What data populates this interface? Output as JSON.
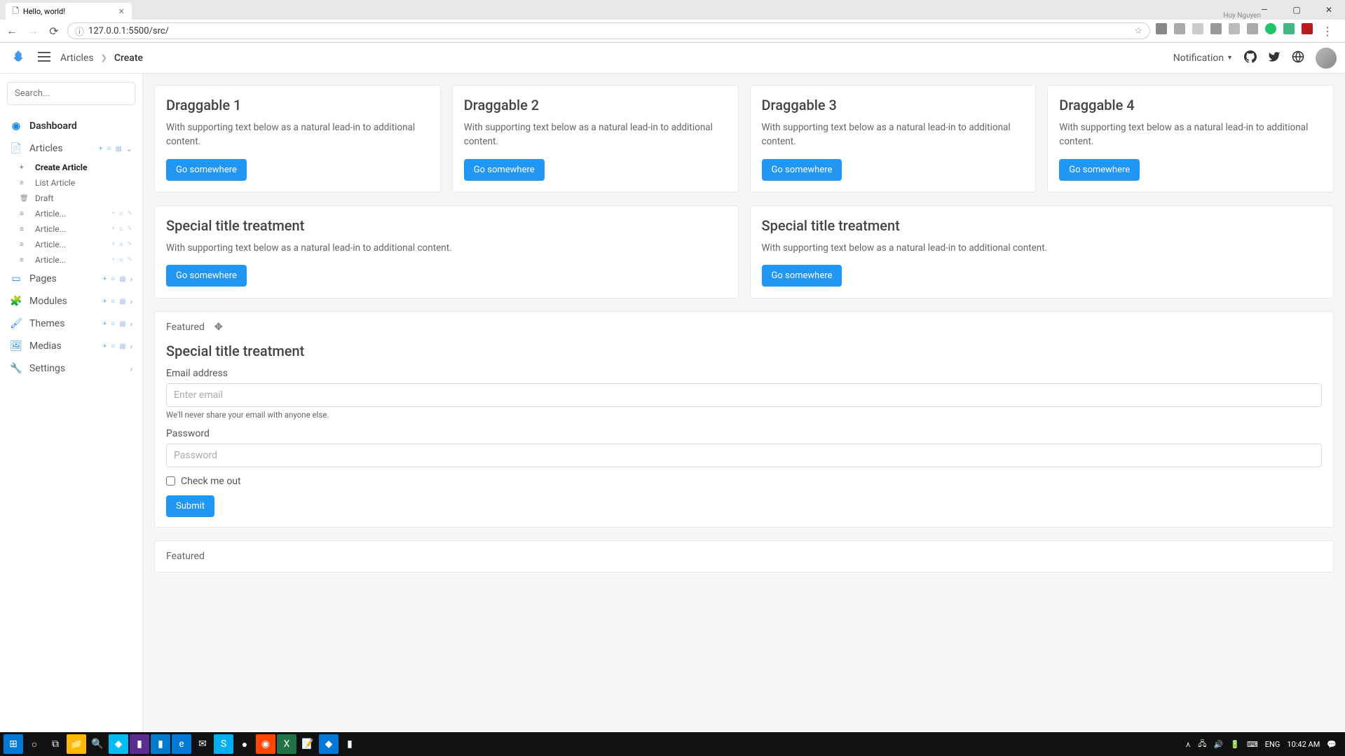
{
  "browser": {
    "tab_title": "Hello, world!",
    "tab_user": "Huy Nguyen",
    "url": "127.0.0.1:5500/src/"
  },
  "header": {
    "breadcrumb_root": "Articles",
    "breadcrumb_current": "Create",
    "notification_label": "Notification"
  },
  "sidebar": {
    "search_placeholder": "Search...",
    "items": {
      "dashboard": "Dashboard",
      "articles": "Articles",
      "pages": "Pages",
      "modules": "Modules",
      "themes": "Themes",
      "medias": "Medias",
      "settings": "Settings"
    },
    "article_subs": {
      "create": "Create Article",
      "list": "List Article",
      "draft": "Draft",
      "a1": "Article...",
      "a2": "Article...",
      "a3": "Article...",
      "a4": "Article..."
    }
  },
  "cards": {
    "drag1_title": "Draggable 1",
    "drag2_title": "Draggable 2",
    "drag3_title": "Draggable 3",
    "drag4_title": "Draggable 4",
    "support_text": "With supporting text below as a natural lead-in to additional content.",
    "go_btn": "Go somewhere",
    "special_title": "Special title treatment"
  },
  "form": {
    "featured_label": "Featured",
    "email_label": "Email address",
    "email_placeholder": "Enter email",
    "email_help": "We'll never share your email with anyone else.",
    "password_label": "Password",
    "password_placeholder": "Password",
    "check_label": "Check me out",
    "submit_label": "Submit"
  },
  "taskbar": {
    "lang": "ENG",
    "time": "10:42 AM"
  }
}
